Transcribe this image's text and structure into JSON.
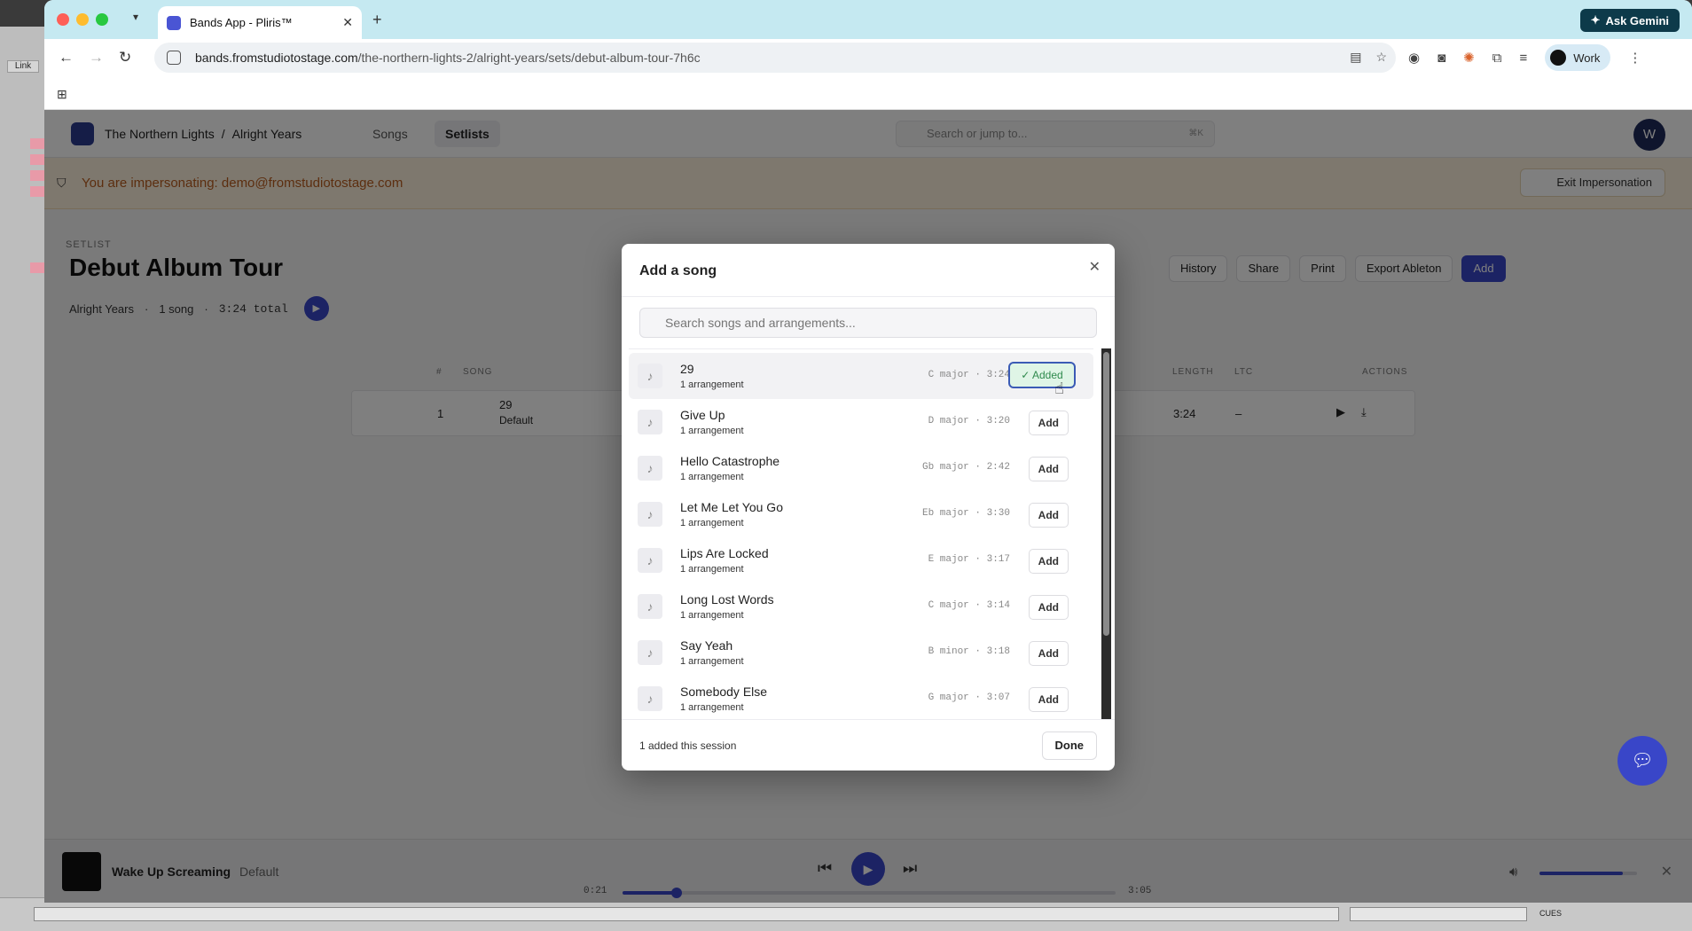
{
  "daw": {
    "link_label": "Link",
    "cues_label": "CUES"
  },
  "browser": {
    "tab_title": "Bands App - Pliris™",
    "url_host": "bands.fromstudiotostage.com",
    "url_path": "/the-northern-lights-2/alright-years/sets/debut-album-tour-7h6c",
    "gemini_label": "Ask Gemini",
    "profile_label": "Work"
  },
  "app": {
    "breadcrumb_band": "The Northern Lights",
    "breadcrumb_separator": "/",
    "breadcrumb_album": "Alright Years",
    "nav_songs": "Songs",
    "nav_setlists": "Setlists",
    "search_placeholder": "Search or jump to...",
    "search_shortcut": "⌘K",
    "user_initial": "W",
    "impersonation_text": "You are impersonating: demo@fromstudiotostage.com",
    "exit_impersonation": "Exit Impersonation",
    "setlist_label": "SETLIST",
    "setlist_title": "Debut Album Tour",
    "setlist_album": "Alright Years",
    "setlist_song_count": "1 song",
    "setlist_total": "3:24 total",
    "actions": {
      "history": "History",
      "share": "Share",
      "print": "Print",
      "export": "Export Ableton",
      "add": "Add"
    },
    "table": {
      "headers": {
        "num": "#",
        "song": "SONG",
        "length": "LENGTH",
        "ltc": "LTC",
        "actions": "ACTIONS"
      },
      "rows": [
        {
          "num": "1",
          "title": "29",
          "arrangement": "Default",
          "length": "3:24",
          "ltc": "–"
        }
      ]
    }
  },
  "player": {
    "title": "Wake Up Screaming",
    "subtitle": "Default",
    "elapsed": "0:21",
    "duration": "3:05",
    "progress_fraction": 0.11,
    "volume_fraction": 0.85
  },
  "modal": {
    "title": "Add a song",
    "search_placeholder": "Search songs and arrangements...",
    "songs": [
      {
        "name": "29",
        "arrangements": "1 arrangement",
        "meta": "C major · 3:24",
        "action": "✓ Added",
        "added": true
      },
      {
        "name": "Give Up",
        "arrangements": "1 arrangement",
        "meta": "D major · 3:20",
        "action": "Add",
        "added": false
      },
      {
        "name": "Hello Catastrophe",
        "arrangements": "1 arrangement",
        "meta": "Gb major · 2:42",
        "action": "Add",
        "added": false
      },
      {
        "name": "Let Me Let You Go",
        "arrangements": "1 arrangement",
        "meta": "Eb major · 3:30",
        "action": "Add",
        "added": false
      },
      {
        "name": "Lips Are Locked",
        "arrangements": "1 arrangement",
        "meta": "E major · 3:17",
        "action": "Add",
        "added": false
      },
      {
        "name": "Long Lost Words",
        "arrangements": "1 arrangement",
        "meta": "C major · 3:14",
        "action": "Add",
        "added": false
      },
      {
        "name": "Say Yeah",
        "arrangements": "1 arrangement",
        "meta": "B minor · 3:18",
        "action": "Add",
        "added": false
      },
      {
        "name": "Somebody Else",
        "arrangements": "1 arrangement",
        "meta": "G major · 3:07",
        "action": "Add",
        "added": false
      }
    ],
    "footer_text": "1 added this session",
    "done_label": "Done"
  },
  "colors": {
    "accent": "#3946c8",
    "impersonation_text": "#b85c1f",
    "added_green": "#2f8a4d",
    "tabbar": "#c5e9f1"
  }
}
